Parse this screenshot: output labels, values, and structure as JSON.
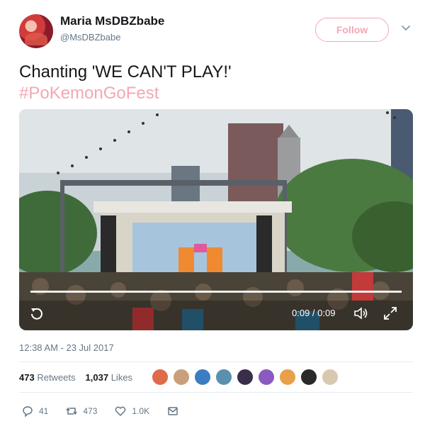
{
  "user": {
    "display_name": "Maria MsDBZbabe",
    "handle": "@MsDBZbabe"
  },
  "follow_label": "Follow",
  "tweet": {
    "text": "Chanting 'WE CAN'T PLAY!'",
    "hashtag": "#PoKemonGoFest"
  },
  "video": {
    "time": "0:09 / 0:09"
  },
  "timestamp": "12:38 AM - 23 Jul 2017",
  "stats": {
    "retweets_count": "473",
    "retweets_label": "Retweets",
    "likes_count": "1,037",
    "likes_label": "Likes"
  },
  "actions": {
    "reply_count": "41",
    "retweet_count": "473",
    "like_count": "1.0K"
  },
  "colors": {
    "accent": "#f4a7b4",
    "secondary_text": "#657786"
  },
  "likers": [
    {
      "name": "liker-avatar-1",
      "color": "#e06b4a"
    },
    {
      "name": "liker-avatar-2",
      "color": "#c8a07a"
    },
    {
      "name": "liker-avatar-3",
      "color": "#3c7cc0"
    },
    {
      "name": "liker-avatar-4",
      "color": "#5a8fb0"
    },
    {
      "name": "liker-avatar-5",
      "color": "#3a2f4a"
    },
    {
      "name": "liker-avatar-6",
      "color": "#8a5ac0"
    },
    {
      "name": "liker-avatar-7",
      "color": "#e8a04a"
    },
    {
      "name": "liker-avatar-8",
      "color": "#2a2a2a"
    },
    {
      "name": "liker-avatar-9",
      "color": "#d8c8b0"
    }
  ]
}
